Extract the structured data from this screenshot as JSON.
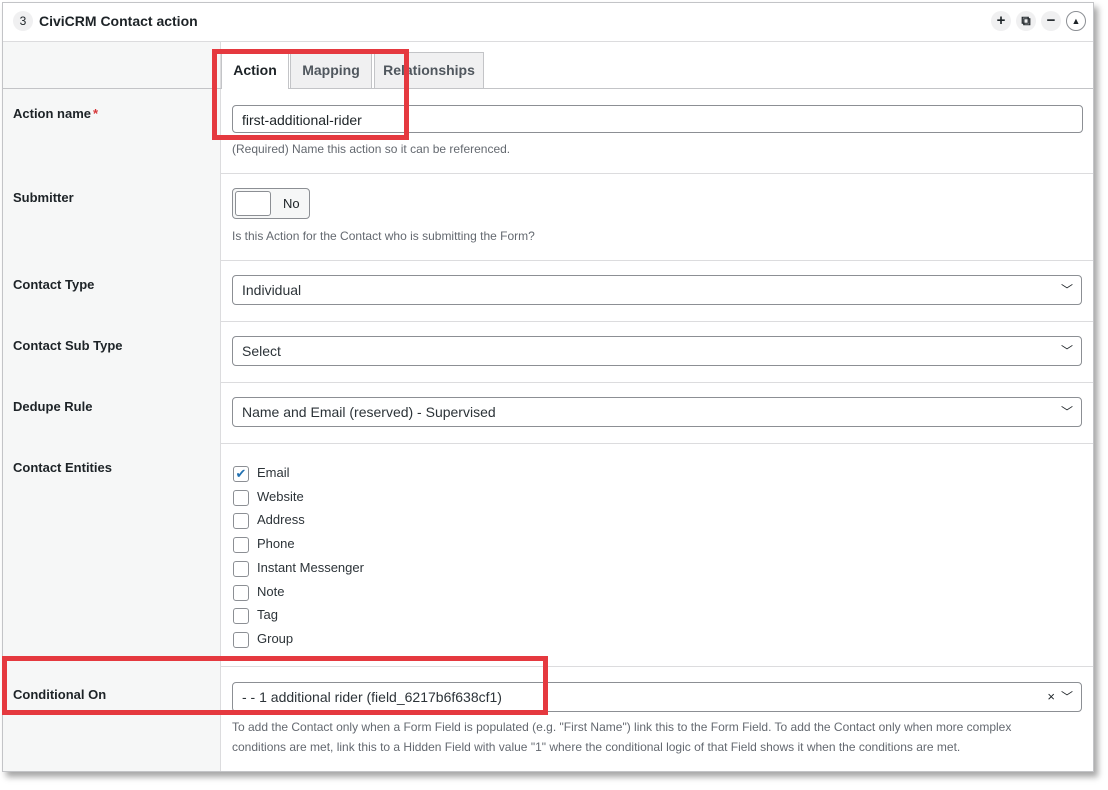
{
  "header": {
    "step": "3",
    "title": "CiviCRM Contact action",
    "buttons": [
      "+",
      "⧉",
      "−",
      "▲"
    ]
  },
  "tabs": [
    {
      "label": "Action",
      "active": true
    },
    {
      "label": "Mapping",
      "active": false
    },
    {
      "label": "Relationships",
      "active": false
    }
  ],
  "action_name": {
    "label": "Action name",
    "required_mark": "*",
    "value": "first-additional-rider",
    "description": "(Required) Name this action so it can be referenced."
  },
  "submitter": {
    "label": "Submitter",
    "toggle_value": "No",
    "description": "Is this Action for the Contact who is submitting the Form?"
  },
  "contact_type": {
    "label": "Contact Type",
    "value": "Individual"
  },
  "contact_sub_type": {
    "label": "Contact Sub Type",
    "value": "Select"
  },
  "dedupe_rule": {
    "label": "Dedupe Rule",
    "value": "Name and Email (reserved) - Supervised"
  },
  "contact_entities": {
    "label": "Contact Entities",
    "items": [
      {
        "label": "Email",
        "checked": true
      },
      {
        "label": "Website",
        "checked": false
      },
      {
        "label": "Address",
        "checked": false
      },
      {
        "label": "Phone",
        "checked": false
      },
      {
        "label": "Instant Messenger",
        "checked": false
      },
      {
        "label": "Note",
        "checked": false
      },
      {
        "label": "Tag",
        "checked": false
      },
      {
        "label": "Group",
        "checked": false
      }
    ]
  },
  "conditional_on": {
    "label": "Conditional On",
    "value": "- - 1 additional rider (field_6217b6f638cf1)",
    "clear": "×",
    "description_line1": "To add the Contact only when a Form Field is populated (e.g. \"First Name\") link this to the Form Field. To add the Contact only when more complex",
    "description_line2": "conditions are met, link this to a Hidden Field with value \"1\" where the conditional logic of that Field shows it when the conditions are met."
  },
  "colors": {
    "highlight": "#e5393f",
    "checkbox_accent": "#2271b1"
  }
}
